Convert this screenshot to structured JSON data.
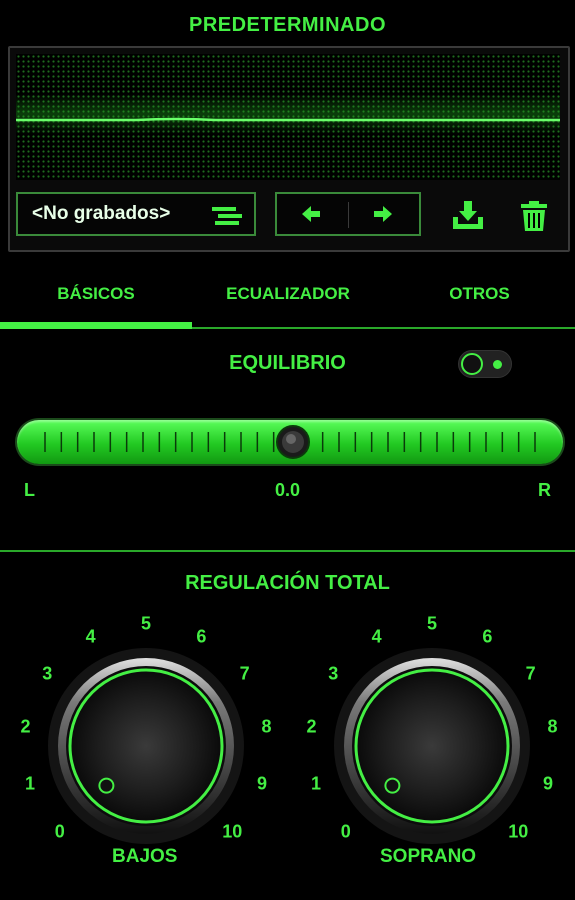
{
  "header": {
    "title": "PREDETERMINADO"
  },
  "preset": {
    "selected": "<No grabados>",
    "menu_icon": "list-menu-icon",
    "prev_icon": "arrow-left-icon",
    "next_icon": "arrow-right-icon",
    "save_icon": "download-icon",
    "delete_icon": "trash-icon"
  },
  "tabs": [
    {
      "label": "BÁSICOS",
      "active": true
    },
    {
      "label": "ECUALIZADOR",
      "active": false
    },
    {
      "label": "OTROS",
      "active": false
    }
  ],
  "balance": {
    "title": "EQUILIBRIO",
    "toggle_on": true,
    "left_label": "L",
    "value": "0.0",
    "right_label": "R",
    "position": 0.5
  },
  "total": {
    "title": "REGULACIÓN TOTAL"
  },
  "knobs": [
    {
      "label": "BAJOS",
      "scale": [
        "0",
        "1",
        "2",
        "3",
        "4",
        "5",
        "6",
        "7",
        "8",
        "9",
        "10"
      ],
      "value": 0
    },
    {
      "label": "SOPRANO",
      "scale": [
        "0",
        "1",
        "2",
        "3",
        "4",
        "5",
        "6",
        "7",
        "8",
        "9",
        "10"
      ],
      "value": 0
    }
  ],
  "colors": {
    "accent": "#44ef44",
    "background": "#000000"
  }
}
